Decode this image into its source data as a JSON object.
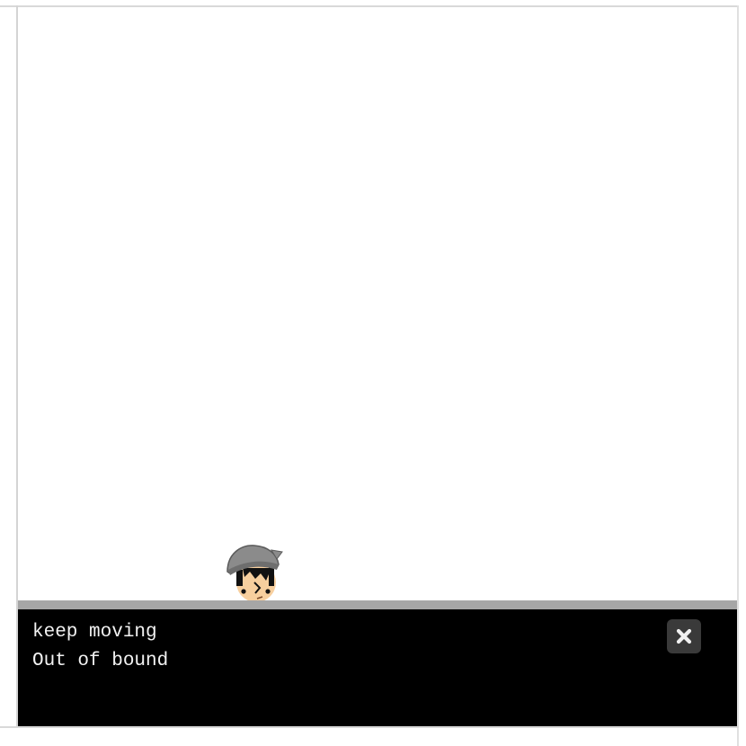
{
  "console": {
    "lines": [
      "keep moving",
      "Out of bound"
    ],
    "close_icon": "close-icon"
  },
  "stage": {
    "sprite": "player-character-head",
    "background_color": "#ffffff",
    "ground_color": "#a6a6a6",
    "console_color": "#000000"
  }
}
